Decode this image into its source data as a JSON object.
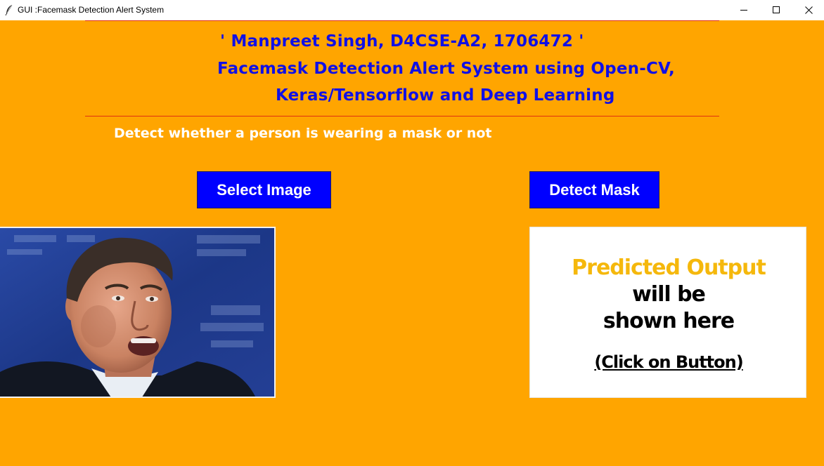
{
  "window": {
    "title": "GUI :Facemask Detection Alert System"
  },
  "header": {
    "line1": "' Manpreet Singh, D4CSE-A2, 1706472 '",
    "line2": "Facemask Detection Alert System using Open-CV,",
    "line3": "Keras/Tensorflow and Deep Learning"
  },
  "subtitle": "Detect whether a person is wearing a mask or not",
  "buttons": {
    "select_image": "Select Image",
    "detect_mask": "Detect Mask"
  },
  "output": {
    "line1": "Predicted Output",
    "line2": "will be",
    "line3": "shown here",
    "line4": "(Click on Button)"
  },
  "colors": {
    "background": "#ffa500",
    "heading": "#1010e6",
    "button_bg": "#0000ff",
    "output_highlight": "#f5b80c"
  },
  "icons": {
    "app": "feather-icon",
    "minimize": "minimize-icon",
    "maximize": "maximize-icon",
    "close": "close-icon"
  }
}
